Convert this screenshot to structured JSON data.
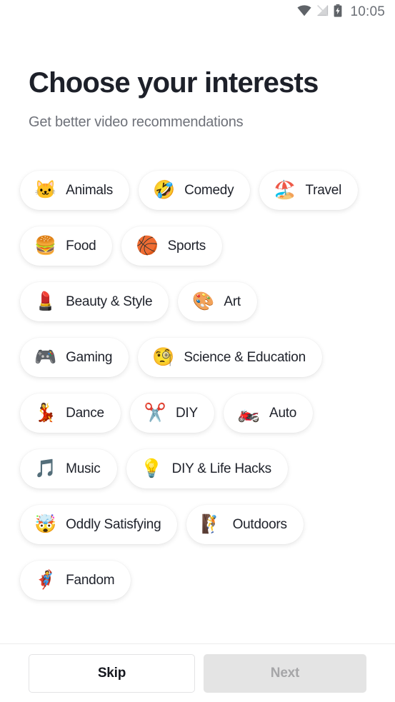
{
  "status_bar": {
    "time": "10:05",
    "icons": [
      "wifi-icon",
      "no-sim-icon",
      "battery-charging-icon"
    ]
  },
  "header": {
    "title": "Choose your interests",
    "subtitle": "Get better video recommendations"
  },
  "interests": [
    {
      "label": "Animals",
      "emoji": "🐱",
      "icon_name": "cat-face-emoji"
    },
    {
      "label": "Comedy",
      "emoji": "🤣",
      "icon_name": "rolling-on-floor-laughing-emoji"
    },
    {
      "label": "Travel",
      "emoji": "🏖️",
      "icon_name": "beach-with-umbrella-emoji"
    },
    {
      "label": "Food",
      "emoji": "🍔",
      "icon_name": "hamburger-emoji"
    },
    {
      "label": "Sports",
      "emoji": "🏀",
      "icon_name": "basketball-emoji"
    },
    {
      "label": "Beauty & Style",
      "emoji": "💄",
      "icon_name": "lipstick-emoji"
    },
    {
      "label": "Art",
      "emoji": "🎨",
      "icon_name": "artist-palette-emoji"
    },
    {
      "label": "Gaming",
      "emoji": "🎮",
      "icon_name": "video-game-controller-emoji"
    },
    {
      "label": "Science & Education",
      "emoji": "🧐",
      "icon_name": "monocle-face-emoji"
    },
    {
      "label": "Dance",
      "emoji": "💃",
      "icon_name": "woman-dancing-emoji"
    },
    {
      "label": "DIY",
      "emoji": "✂️",
      "icon_name": "scissors-emoji"
    },
    {
      "label": "Auto",
      "emoji": "🏍️",
      "icon_name": "motorcycle-emoji"
    },
    {
      "label": "Music",
      "emoji": "🎵",
      "icon_name": "musical-note-emoji"
    },
    {
      "label": "DIY & Life Hacks",
      "emoji": "💡",
      "icon_name": "light-bulb-emoji"
    },
    {
      "label": "Oddly Satisfying",
      "emoji": "🤯",
      "icon_name": "exploding-head-emoji"
    },
    {
      "label": "Outdoors",
      "emoji": "🧗",
      "icon_name": "person-climbing-emoji"
    },
    {
      "label": "Fandom",
      "emoji": "🦸",
      "icon_name": "superhero-emoji"
    }
  ],
  "footer": {
    "skip_label": "Skip",
    "next_label": "Next"
  },
  "colors": {
    "background": "#ffffff",
    "title_text": "#1d2029",
    "subtitle_text": "#6e7179",
    "chip_background": "#ffffff",
    "chip_text": "#20232c",
    "next_disabled_background": "#e4e4e4",
    "next_disabled_text": "#a6a6a8",
    "separator": "#ececec"
  }
}
